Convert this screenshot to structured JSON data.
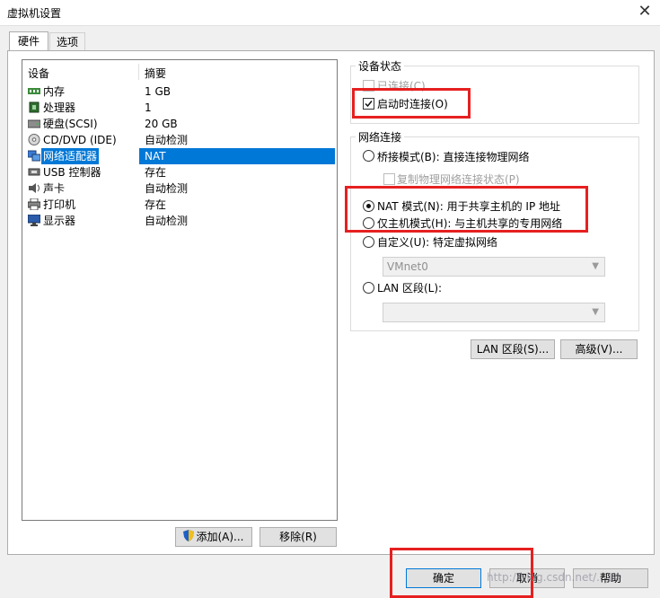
{
  "window": {
    "title": "虚拟机设置",
    "close_glyph": "✕"
  },
  "tabs": [
    {
      "label": "硬件"
    },
    {
      "label": "选项"
    }
  ],
  "device_list": {
    "header_device": "设备",
    "header_summary": "摘要",
    "rows": [
      {
        "name": "内存",
        "summary": "1 GB",
        "icon": "memory-icon"
      },
      {
        "name": "处理器",
        "summary": "1",
        "icon": "processor-icon"
      },
      {
        "name": "硬盘(SCSI)",
        "summary": "20 GB",
        "icon": "hard-disk-icon"
      },
      {
        "name": "CD/DVD (IDE)",
        "summary": "自动检测",
        "icon": "cd-dvd-icon"
      },
      {
        "name": "网络适配器",
        "summary": "NAT",
        "icon": "network-adapter-icon",
        "selected": true
      },
      {
        "name": "USB 控制器",
        "summary": "存在",
        "icon": "usb-icon"
      },
      {
        "name": "声卡",
        "summary": "自动检测",
        "icon": "sound-card-icon"
      },
      {
        "name": "打印机",
        "summary": "存在",
        "icon": "printer-icon"
      },
      {
        "name": "显示器",
        "summary": "自动检测",
        "icon": "display-icon"
      }
    ]
  },
  "list_buttons": {
    "add": "添加(A)...",
    "remove": "移除(R)"
  },
  "device_status": {
    "group_label": "设备状态",
    "connected": "已连接(C)",
    "connect_at_power_on": "启动时连接(O)"
  },
  "network": {
    "group_label": "网络连接",
    "bridged": "桥接模式(B): 直接连接物理网络",
    "replicate_state": "复制物理网络连接状态(P)",
    "nat": "NAT 模式(N): 用于共享主机的 IP 地址",
    "host_only": "仅主机模式(H): 与主机共享的专用网络",
    "custom": "自定义(U): 特定虚拟网络",
    "custom_select_value": "VMnet0",
    "lan_segment": "LAN 区段(L):",
    "lan_select_value": ""
  },
  "network_buttons": {
    "lan_segments": "LAN 区段(S)...",
    "advanced": "高级(V)..."
  },
  "footer": {
    "ok": "确定",
    "cancel": "取消",
    "help": "帮助"
  },
  "watermark": "http://blog.csdn.net/...14",
  "colors": {
    "selection": "#0078d7",
    "highlight_box": "#e62020"
  }
}
